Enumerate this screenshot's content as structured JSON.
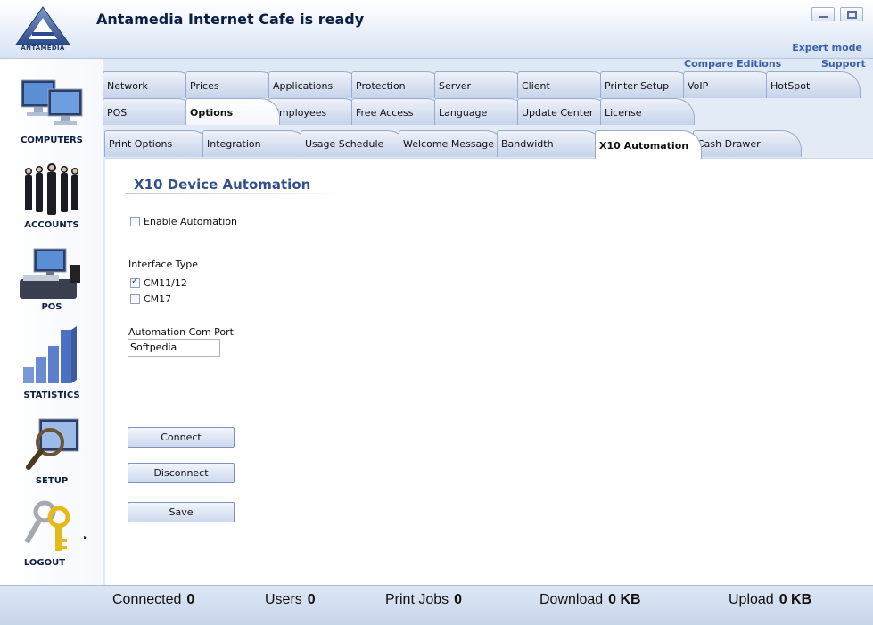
{
  "header": {
    "title": "Antamedia Internet Cafe is ready",
    "logo_text": "ANTAMEDIA",
    "expert_mode": "Expert mode",
    "compare_editions": "Compare Editions",
    "support": "Support"
  },
  "sidebar": {
    "items": [
      {
        "label": "COMPUTERS",
        "icon": "monitors-icon"
      },
      {
        "label": "ACCOUNTS",
        "icon": "people-icon"
      },
      {
        "label": "POS",
        "icon": "cash-register-icon"
      },
      {
        "label": "STATISTICS",
        "icon": "bar-chart-icon"
      },
      {
        "label": "SETUP",
        "icon": "magnifier-icon"
      },
      {
        "label": "LOGOUT",
        "icon": "keys-icon"
      }
    ]
  },
  "tabs_row1": [
    "Network",
    "Prices",
    "Applications",
    "Protection",
    "Server",
    "Client",
    "Printer Setup",
    "VoIP",
    "HotSpot"
  ],
  "tabs_row2": [
    "POS",
    "Options",
    "Employees",
    "Free Access",
    "Language",
    "Update Center",
    "License"
  ],
  "active_tab": "Options",
  "subtabs": [
    "Print Options",
    "Integration",
    "Usage Schedule",
    "Welcome Message",
    "Bandwidth",
    "X10 Automation",
    "Cash Drawer"
  ],
  "active_subtab": "X10 Automation",
  "panel": {
    "section_title": "X10 Device Automation",
    "enable_automation": {
      "label": "Enable Automation",
      "checked": false
    },
    "interface_type_label": "Interface Type",
    "cm11": {
      "label": "CM11/12",
      "checked": true
    },
    "cm17": {
      "label": "CM17",
      "checked": false
    },
    "com_port_label": "Automation Com Port",
    "com_port_value": "Softpedia",
    "connect_label": "Connect",
    "disconnect_label": "Disconnect",
    "save_label": "Save"
  },
  "status": {
    "connected_label": "Connected",
    "connected_value": "0",
    "users_label": "Users",
    "users_value": "0",
    "print_jobs_label": "Print Jobs",
    "print_jobs_value": "0",
    "download_label": "Download",
    "download_value": "0 KB",
    "upload_label": "Upload",
    "upload_value": "0 KB"
  },
  "colors": {
    "accent": "#3a5fa8",
    "title": "#33508a",
    "tab_bg": "#c6d3ea",
    "panel_bg": "#ffffff"
  }
}
